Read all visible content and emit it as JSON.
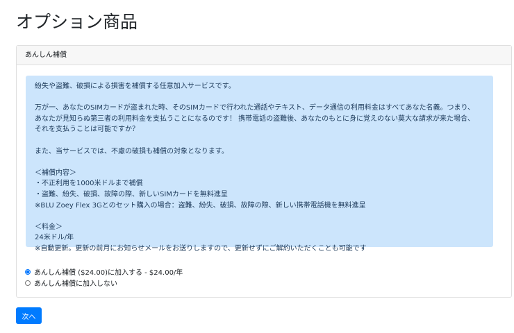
{
  "title": "オプション商品",
  "card": {
    "header": "あんしん補償",
    "paragraphs": [
      "紛失や盗難、破損による損害を補償する任意加入サービスです。",
      "",
      "万が一、あなたのSIMカードが盗まれた時、そのSIMカードで行われた通話やテキスト、データ通信の利用料金はすべてあなた名義。つまり、",
      "あなたが見知らぬ第三者の利用料金を支払うことになるのです！ 携帯電話の盗難後、あなたのもとに身に覚えのない莫大な請求が来た場合、",
      "それを支払うことは可能ですか？",
      "",
      "また、当サービスでは、不慮の破損も補償の対象となります。",
      "",
      "＜補償内容＞",
      "・不正利用を1000米ドルまで補償",
      "・盗難、紛失、破損、故障の際、新しいSIMカードを無料進呈",
      "※BLU Zoey Flex 3Gとのセット購入の場合：盗難、紛失、破損、故障の際、新しい携帯電話機を無料進呈",
      "",
      "＜料金＞",
      "24米ドル/年",
      "※自動更新。更新の前月にお知らせメールをお送りしますので、更新せずにご解約いただくことも可能です"
    ],
    "options": [
      {
        "label": "あんしん補償 ($24.00)に加入する - $24.00/年",
        "checked": true
      },
      {
        "label": "あんしん補償に加入しない",
        "checked": false
      }
    ]
  },
  "next_button": "次へ"
}
